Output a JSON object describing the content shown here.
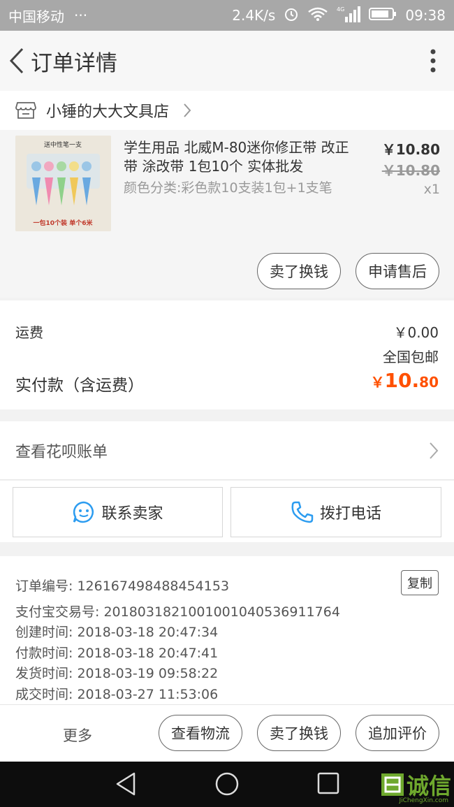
{
  "status_bar": {
    "carrier": "中国移动",
    "dots": "···",
    "speed": "2.4K/s",
    "network": "4G",
    "time": "09:38"
  },
  "header": {
    "title": "订单详情"
  },
  "shop": {
    "name": "小锤的大大文具店"
  },
  "product": {
    "title": "学生用品 北威M-80迷你修正带 改正带 涂改带 1包10个 实体批发",
    "spec": "颜色分类:彩色款10支装1包+1支笔",
    "price": "￥10.80",
    "original_price": "￥10.80",
    "quantity": "x1",
    "thumb_text_top": "送中性笔一支",
    "thumb_text_bottom": "一包10个装 单个6米",
    "sell_button": "卖了换钱",
    "aftersale_button": "申请售后"
  },
  "fees": {
    "shipping_label": "运费",
    "shipping_value": "￥0.00",
    "shipping_note": "全国包邮",
    "total_label": "实付款（含运费）",
    "total_currency": "￥",
    "total_int": "10.",
    "total_dec": "80"
  },
  "huabei": {
    "label": "查看花呗账单"
  },
  "contact": {
    "seller": "联系卖家",
    "phone": "拨打电话"
  },
  "order_info": {
    "copy": "复制",
    "rows": [
      "订单编号: 126167498488454153",
      "支付宝交易号: 2018031821001001040536911764",
      "创建时间: 2018-03-18 20:47:34",
      "付款时间: 2018-03-18 20:47:41",
      "发货时间: 2018-03-19 09:58:22",
      "成交时间: 2018-03-27 11:53:06"
    ]
  },
  "bottom_bar": {
    "more": "更多",
    "logistics": "查看物流",
    "sell": "卖了换钱",
    "review": "追加评价"
  },
  "watermark": {
    "text": "诚信",
    "sub": "JiChengXin.com"
  },
  "colors": {
    "accent": "#ff5000",
    "icon_blue": "#2c9cf0",
    "watermark_green": "#6ea82d"
  }
}
